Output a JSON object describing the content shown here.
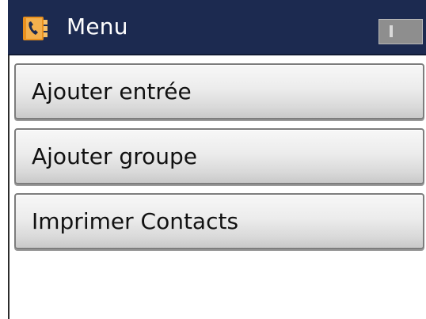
{
  "header": {
    "title": "Menu",
    "icon": "contacts-book-icon",
    "status_icon": "status-indicator-icon"
  },
  "menu": {
    "items": [
      {
        "label": "Ajouter entrée"
      },
      {
        "label": "Ajouter groupe"
      },
      {
        "label": "Imprimer Contacts"
      }
    ]
  },
  "colors": {
    "header_background": "#1c2a50",
    "icon_accent": "#e8901e",
    "button_face": "#e6e6e6"
  }
}
